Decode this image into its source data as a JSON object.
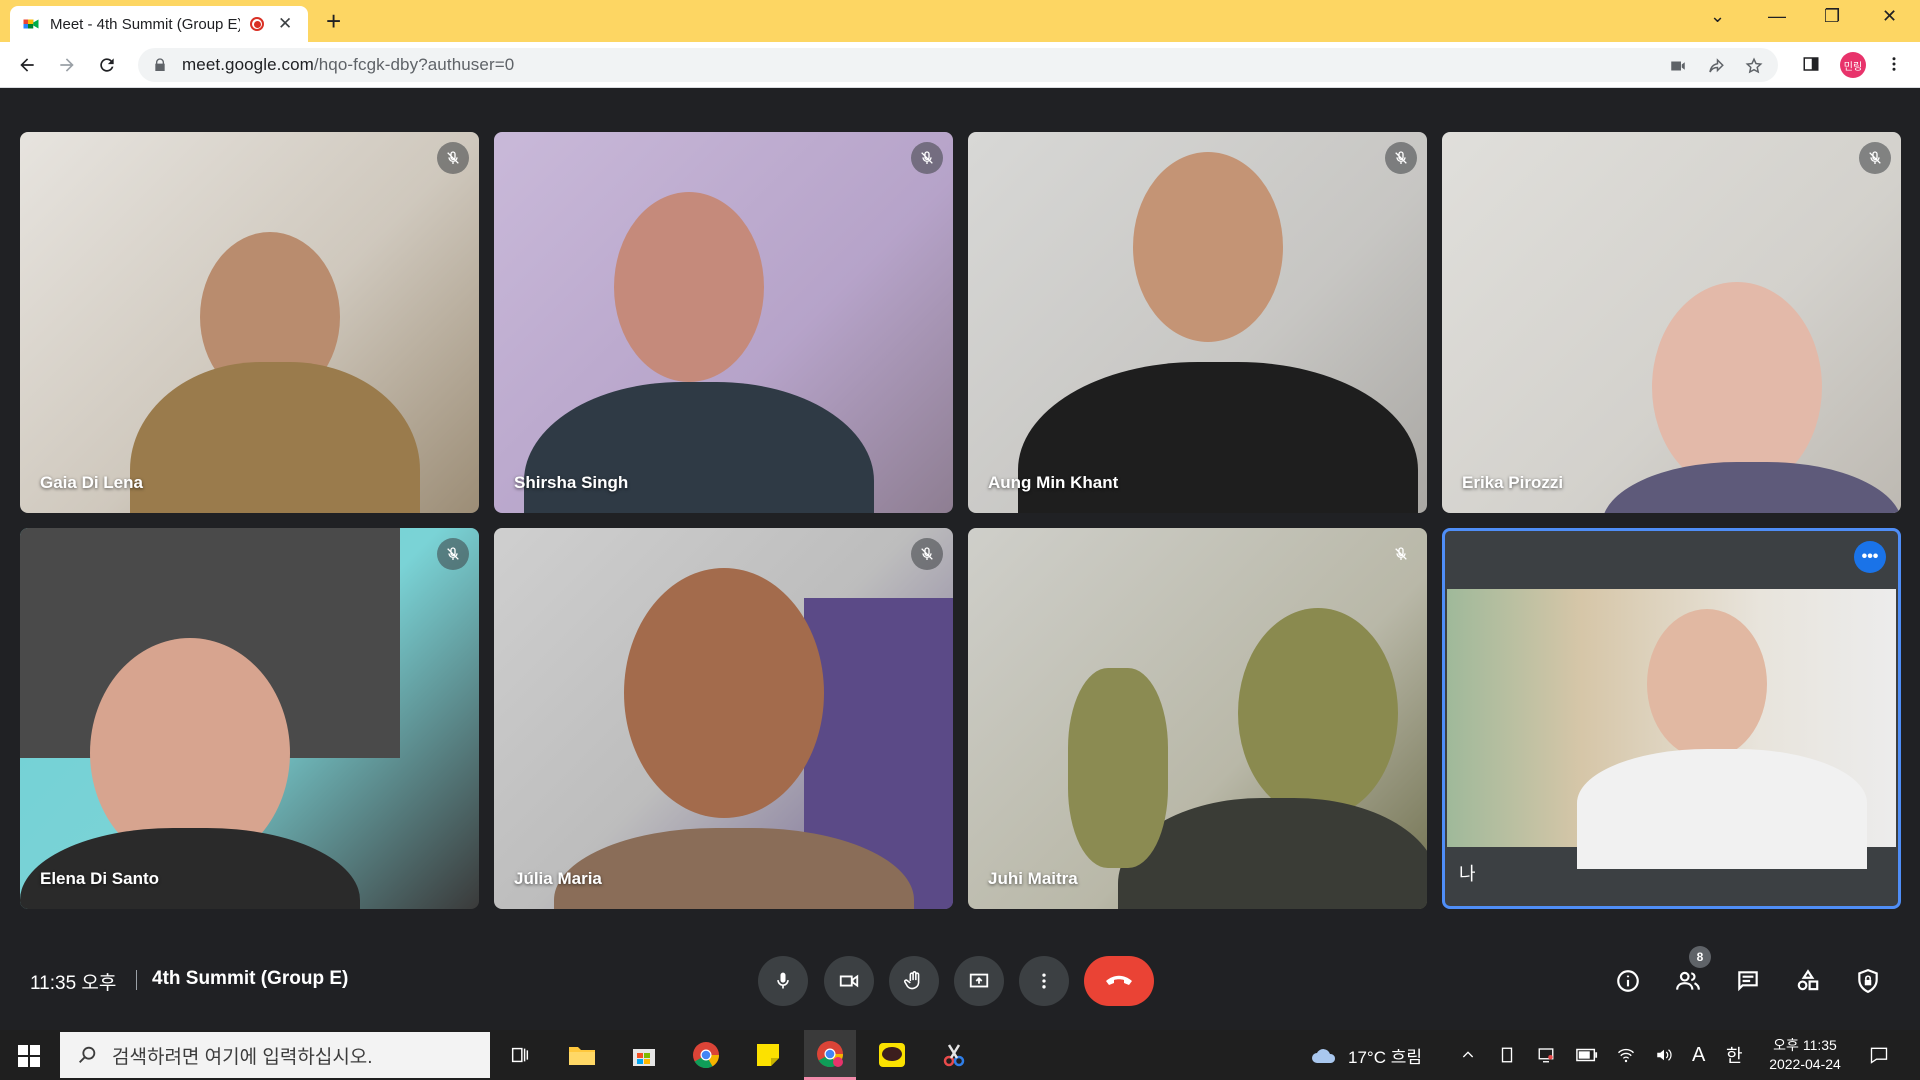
{
  "browser": {
    "tab_title": "Meet - 4th Summit (Group E)",
    "url_domain": "meet.google.com",
    "url_path": "/hqo-fcgk-dby?authuser=0",
    "profile_label": "민링"
  },
  "participants": [
    {
      "name": "Gaia Di Lena",
      "muted": true
    },
    {
      "name": "Shirsha Singh",
      "muted": true
    },
    {
      "name": "Aung Min Khant",
      "muted": true
    },
    {
      "name": "Erika Pirozzi",
      "muted": true
    },
    {
      "name": "Elena Di Santo",
      "muted": true
    },
    {
      "name": "Júlia Maria",
      "muted": true
    },
    {
      "name": "Juhi Maitra",
      "muted": true
    }
  ],
  "self_tile": {
    "name": "나"
  },
  "meeting": {
    "time": "11:35 오후",
    "title": "4th Summit (Group E)",
    "people_count": "8"
  },
  "taskbar": {
    "search_placeholder": "검색하려면 여기에 입력하십시오.",
    "weather": "17°C 흐림",
    "ime_a": "A",
    "ime_lang": "한",
    "clock_time": "오후 11:35",
    "clock_date": "2022-04-24"
  },
  "colors": {
    "titlebar": "#fdd663",
    "meet_bg": "#202124",
    "end_call": "#ea4335",
    "self_border": "#4f8ef7"
  }
}
